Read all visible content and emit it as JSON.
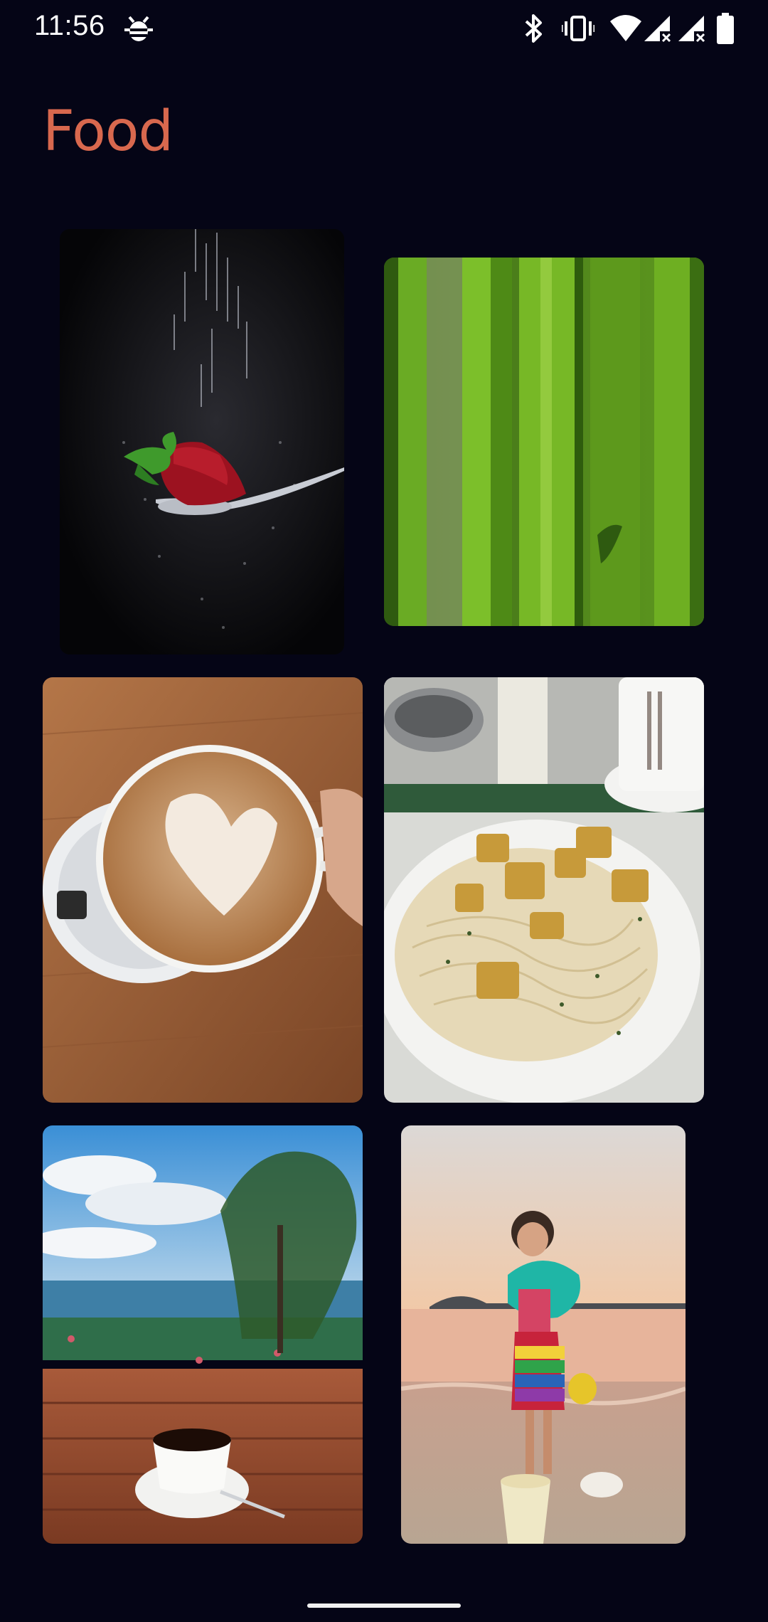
{
  "status_bar": {
    "time": "11:56",
    "icons": [
      "debug-bug-icon",
      "bluetooth-icon",
      "vibrate-icon",
      "wifi-icon",
      "signal-icon",
      "signal-no-service-icon",
      "battery-icon"
    ]
  },
  "page": {
    "title": "Food",
    "title_color": "#d8684e",
    "background": "#050516"
  },
  "gallery": {
    "tiles": [
      {
        "name": "photo-strawberry-spoon"
      },
      {
        "name": "photo-green-leaves"
      },
      {
        "name": "photo-latte-art"
      },
      {
        "name": "photo-pasta-croutons"
      },
      {
        "name": "photo-coffee-seaside"
      },
      {
        "name": "photo-child-beach"
      }
    ]
  }
}
